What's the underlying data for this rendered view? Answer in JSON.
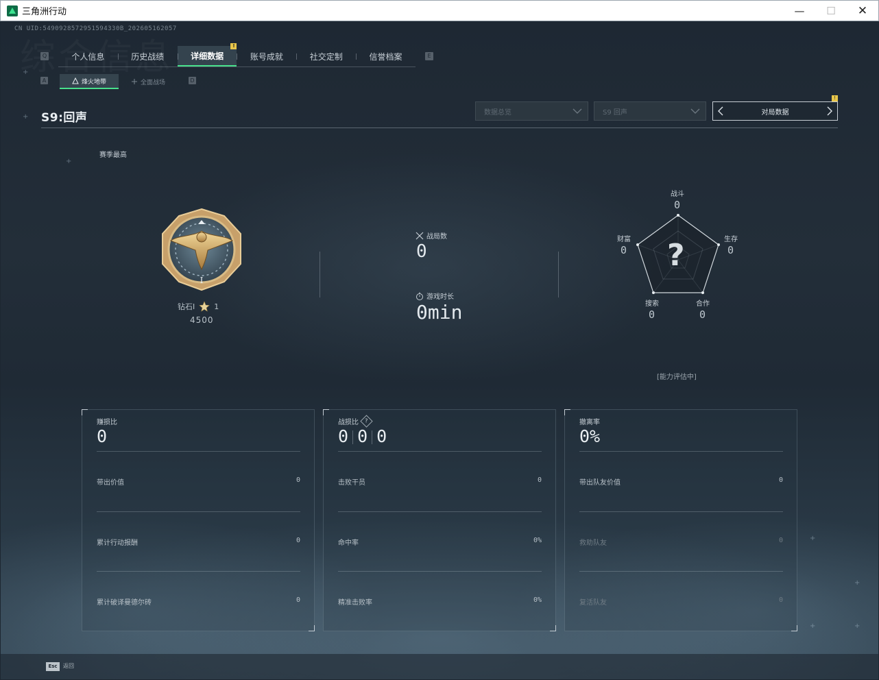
{
  "window": {
    "title": "三角洲行动",
    "minimize": "—",
    "maximize": "☐",
    "close": "✕"
  },
  "cnuid": "CN UID:5490928572951594330B_202605162057",
  "watermark": "综合信息",
  "main_tabs": [
    {
      "label": "个人信息"
    },
    {
      "label": "历史战绩"
    },
    {
      "label": "详细数据",
      "active": true,
      "badge": "!"
    },
    {
      "label": "账号成就"
    },
    {
      "label": "社交定制"
    },
    {
      "label": "信誉档案"
    }
  ],
  "main_tab_keys": {
    "left": "Q",
    "right": "E"
  },
  "sub_tabs": [
    {
      "label": "烽火地带",
      "active": true
    },
    {
      "label": "全面战场"
    }
  ],
  "sub_tab_keys": {
    "left": "A",
    "right": "D"
  },
  "season": {
    "title": "S9:回声"
  },
  "filters": {
    "data_scope": "数据总览",
    "season_select": "S9 回声",
    "pager_label": "对局数据",
    "pager_badge": "!"
  },
  "rank": {
    "caption": "赛季最高",
    "name": "钻石I",
    "stars": "1",
    "score": "4500"
  },
  "summary": {
    "matches_label": "战局数",
    "matches_value": "0",
    "playtime_label": "游戏时长",
    "playtime_value": "0min"
  },
  "radar": {
    "labels": {
      "combat": "战斗",
      "survival": "生存",
      "cooperation": "合作",
      "search": "搜索",
      "wealth": "财富"
    },
    "values": {
      "combat": "0",
      "survival": "0",
      "cooperation": "0",
      "search": "0",
      "wealth": "0"
    },
    "center": "?",
    "status": "[能力评估中]"
  },
  "panels": {
    "profit": {
      "title": "赚损比",
      "value": "0",
      "rows": [
        {
          "label": "带出价值",
          "value": "0"
        },
        {
          "label": "累计行动报酬",
          "value": "0"
        },
        {
          "label": "累计破译曼德尔砖",
          "value": "0"
        }
      ]
    },
    "kd": {
      "title": "战损比",
      "help": "?",
      "values": [
        "0",
        "0",
        "0"
      ],
      "rows": [
        {
          "label": "击败干员",
          "value": "0"
        },
        {
          "label": "命中率",
          "value": "0%"
        },
        {
          "label": "精准击败率",
          "value": "0%"
        }
      ]
    },
    "extract": {
      "title": "撤离率",
      "value": "0%",
      "rows": [
        {
          "label": "带出队友价值",
          "value": "0"
        },
        {
          "label": "救助队友",
          "value": "0"
        },
        {
          "label": "复活队友",
          "value": "0"
        }
      ]
    }
  },
  "footer": {
    "esc_key": "Esc",
    "esc_label": "返回"
  },
  "colors": {
    "accent": "#48e18c",
    "badge": "#e8c64a",
    "background": "#1d2731"
  }
}
